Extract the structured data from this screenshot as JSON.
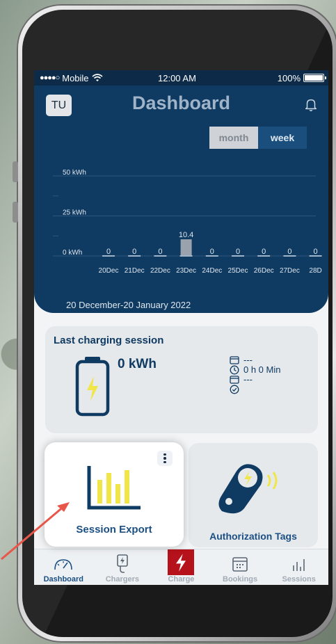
{
  "status_bar": {
    "carrier": "Mobile",
    "time": "12:00 AM",
    "battery": "100%"
  },
  "header": {
    "avatar": "TU",
    "title": "Dashboard"
  },
  "period_toggle": {
    "options": [
      "month",
      "week"
    ],
    "selected": "week"
  },
  "chart_data": {
    "type": "bar",
    "y_ticks": [
      "50 kWh",
      "25 kWh",
      "0 kWh"
    ],
    "ylim": [
      0,
      50
    ],
    "categories": [
      "20Dec",
      "21Dec",
      "22Dec",
      "23Dec",
      "24Dec",
      "25Dec",
      "26Dec",
      "27Dec",
      "28D"
    ],
    "values": [
      0,
      0,
      0,
      10.4,
      0,
      0,
      0,
      0,
      0
    ],
    "value_labels": [
      "0",
      "0",
      "0",
      "10.4",
      "0",
      "0",
      "0",
      "0",
      "0"
    ],
    "date_range": "20 December-20 January 2022",
    "colors": {
      "background": "#0f3a61",
      "bar": "#9aa3ad",
      "text": "#dfe7ef"
    }
  },
  "last_session": {
    "heading": "Last charging session",
    "energy": "0 kWh",
    "date": "---",
    "duration": "0 h 0 Min",
    "end": "---"
  },
  "cards": {
    "session_export": "Session Export",
    "authorization_tags": "Authorization Tags"
  },
  "tabs": [
    {
      "label": "Dashboard",
      "icon": "speedometer-icon"
    },
    {
      "label": "Chargers",
      "icon": "charger-plug-icon"
    },
    {
      "label": "Charge",
      "icon": "lightning-icon"
    },
    {
      "label": "Bookings",
      "icon": "calendar-icon"
    },
    {
      "label": "Sessions",
      "icon": "bar-chart-icon"
    }
  ],
  "accent_colors": {
    "navy": "#0f3a61",
    "yellow": "#f0e64a",
    "red": "#b5121b",
    "arrow": "#e8564a"
  }
}
